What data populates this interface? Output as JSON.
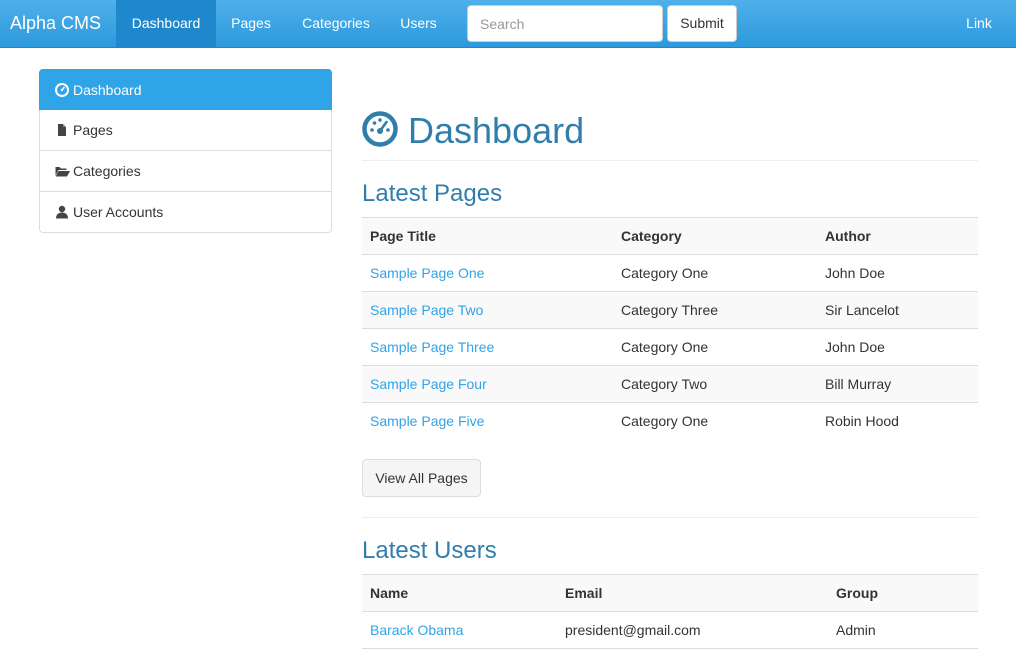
{
  "navbar": {
    "brand": "Alpha CMS",
    "items": [
      {
        "label": "Dashboard",
        "active": true
      },
      {
        "label": "Pages",
        "active": false
      },
      {
        "label": "Categories",
        "active": false
      },
      {
        "label": "Users",
        "active": false
      }
    ],
    "search_placeholder": "Search",
    "submit_label": "Submit",
    "right_link": "Link"
  },
  "sidebar": {
    "items": [
      {
        "label": "Dashboard",
        "icon": "dashboard-icon",
        "active": true
      },
      {
        "label": "Pages",
        "icon": "file-icon",
        "active": false
      },
      {
        "label": "Categories",
        "icon": "folder-open-icon",
        "active": false
      },
      {
        "label": "User Accounts",
        "icon": "user-icon",
        "active": false
      }
    ]
  },
  "main": {
    "title": "Dashboard",
    "latest_pages": {
      "heading": "Latest Pages",
      "columns": [
        "Page Title",
        "Category",
        "Author"
      ],
      "rows": [
        [
          "Sample Page One",
          "Category One",
          "John Doe"
        ],
        [
          "Sample Page Two",
          "Category Three",
          "Sir Lancelot"
        ],
        [
          "Sample Page Three",
          "Category One",
          "John Doe"
        ],
        [
          "Sample Page Four",
          "Category Two",
          "Bill Murray"
        ],
        [
          "Sample Page Five",
          "Category One",
          "Robin Hood"
        ]
      ],
      "view_all_label": "View All Pages"
    },
    "latest_users": {
      "heading": "Latest Users",
      "columns": [
        "Name",
        "Email",
        "Group"
      ],
      "rows": [
        [
          "Barack Obama",
          "president@gmail.com",
          "Admin"
        ]
      ]
    }
  },
  "colors": {
    "accent": "#2fa4e7",
    "heading": "#317eac",
    "nav_active": "#1f87cc"
  }
}
